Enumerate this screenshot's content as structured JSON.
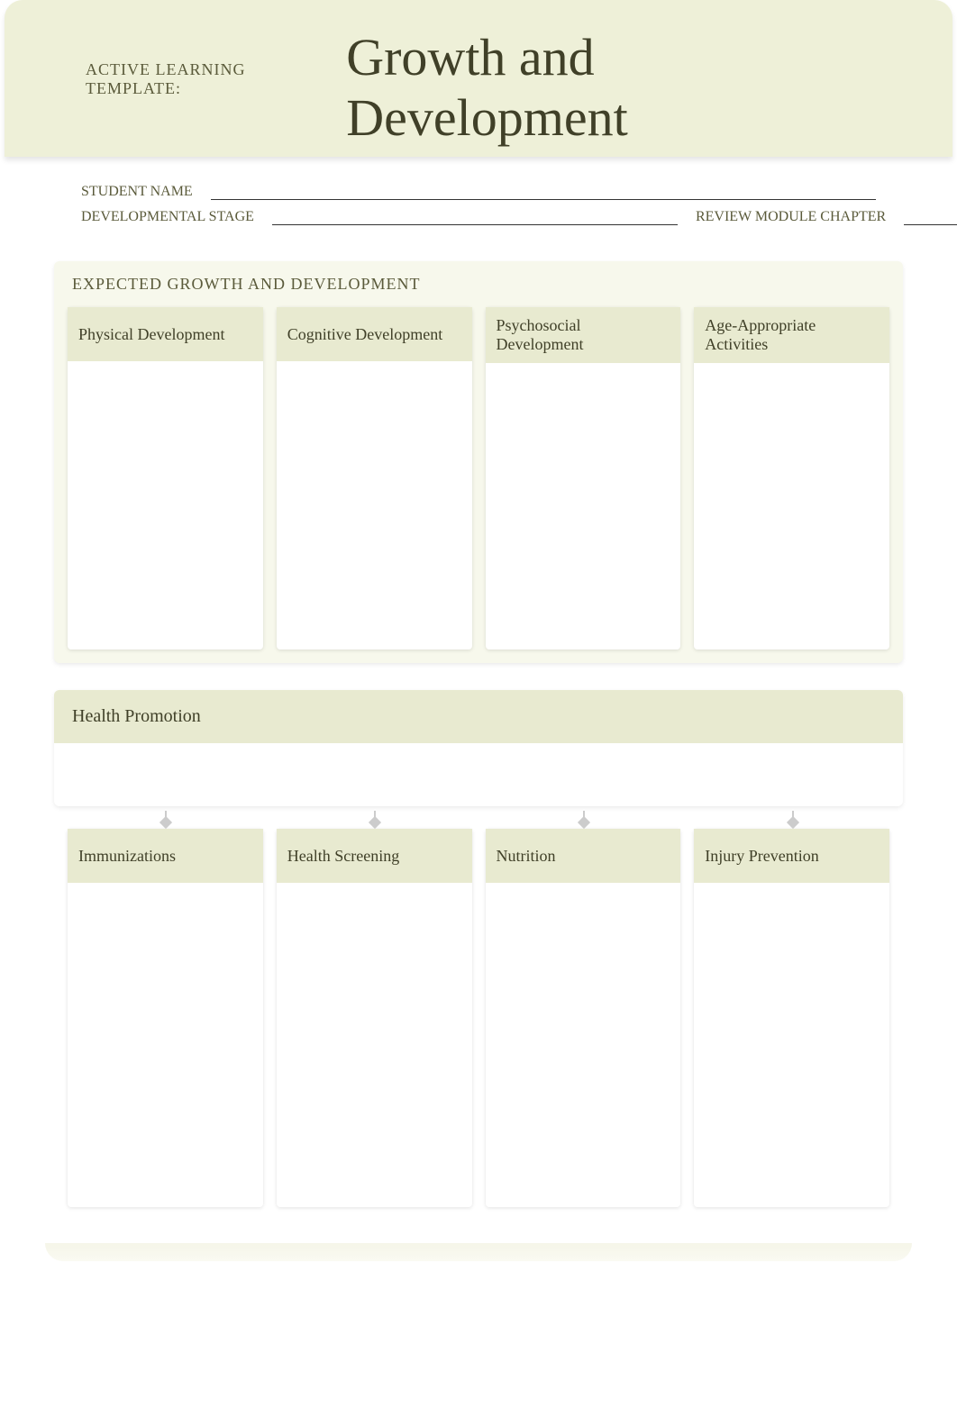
{
  "header": {
    "template_label": "ACTIVE LEARNING TEMPLATE:",
    "main_title": "Growth and Development"
  },
  "form": {
    "student_name_label": "STUDENT NAME",
    "student_name_value": "",
    "dev_stage_label": "DEVELOPMENTAL STAGE",
    "dev_stage_value": "",
    "review_chapter_label": "REVIEW MODULE CHAPTER",
    "review_chapter_value": ""
  },
  "expected_section": {
    "heading": "EXPECTED GROWTH AND DEVELOPMENT",
    "cards": [
      {
        "title": "Physical Development",
        "body": ""
      },
      {
        "title": "Cognitive Development",
        "body": ""
      },
      {
        "title": "Psychosocial Development",
        "body": ""
      },
      {
        "title": "Age-Appropriate Activities",
        "body": ""
      }
    ]
  },
  "health_promotion": {
    "heading": "Health Promotion",
    "top_body": "",
    "cards": [
      {
        "title": "Immunizations",
        "body": ""
      },
      {
        "title": "Health Screening",
        "body": ""
      },
      {
        "title": "Nutrition",
        "body": ""
      },
      {
        "title": "Injury Prevention",
        "body": ""
      }
    ]
  }
}
